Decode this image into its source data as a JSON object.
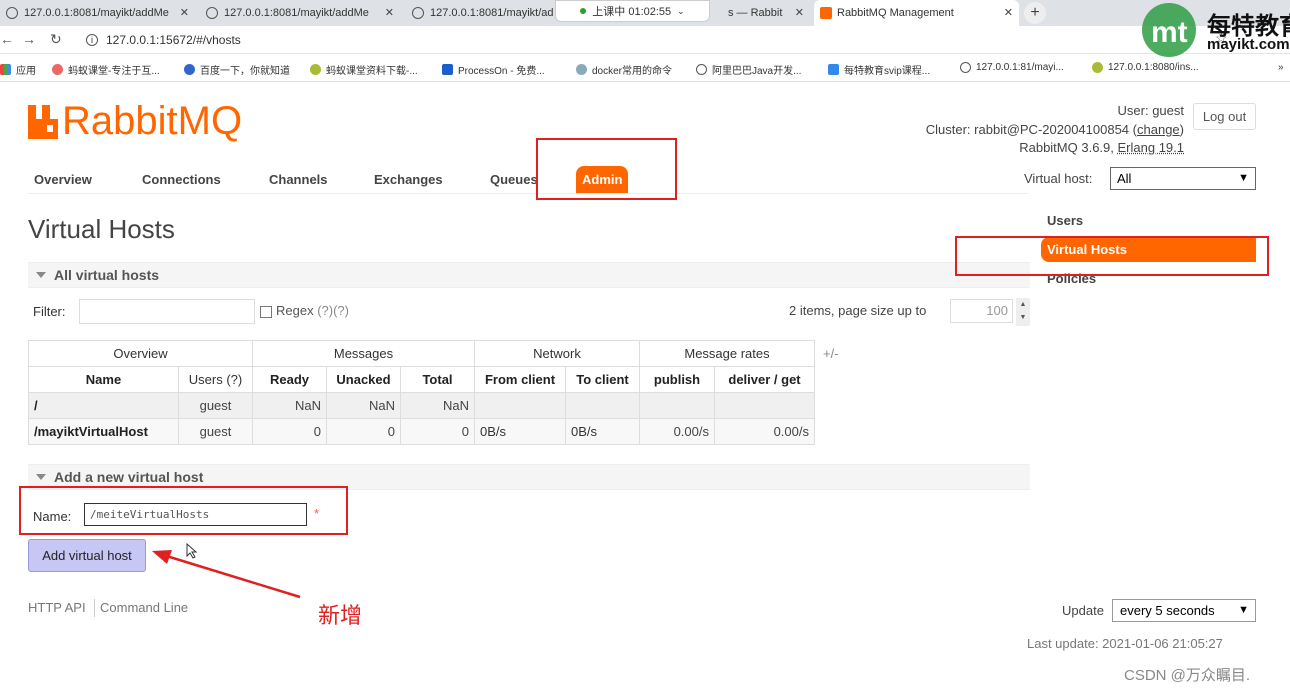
{
  "browser": {
    "tabs": [
      {
        "title": "127.0.0.1:8081/mayikt/addMe"
      },
      {
        "title": "127.0.0.1:8081/mayikt/addMe"
      },
      {
        "title": "127.0.0.1:8081/mayikt/ad"
      },
      {
        "title": "s — Rabbit"
      },
      {
        "title": "RabbitMQ Management"
      }
    ],
    "recording": "上课中 01:02:55",
    "url": "127.0.0.1:15672/#/vhosts",
    "bookmarks": [
      "应用",
      "蚂蚁课堂-专注于互...",
      "百度一下，你就知道",
      "蚂蚁课堂资料下载-...",
      "ProcessOn - 免费...",
      "docker常用的命令",
      "阿里巴巴Java开发...",
      "每特教育svip课程...",
      "127.0.0.1:81/mayi...",
      "127.0.0.1:8080/ins..."
    ],
    "watermark": {
      "line1": "每特教育",
      "line2": "mayikt.com"
    }
  },
  "app": {
    "logo_text": "RabbitMQ",
    "user_label": "User:",
    "user": "guest",
    "logout": "Log out",
    "cluster_label": "Cluster:",
    "cluster": "rabbit@PC-202004100854",
    "change": "change",
    "version": "RabbitMQ 3.6.9,",
    "erlang": "Erlang 19.1",
    "nav": [
      "Overview",
      "Connections",
      "Channels",
      "Exchanges",
      "Queues",
      "Admin"
    ],
    "vhost_label": "Virtual host:",
    "vhost_value": "All",
    "side": [
      "Users",
      "Virtual Hosts",
      "Policies"
    ]
  },
  "page": {
    "title": "Virtual Hosts",
    "all_section": "All virtual hosts",
    "filter_label": "Filter:",
    "regex": "Regex",
    "regex_help": "(?)(?)",
    "items_label": "2 items, page size up to",
    "page_size": "100",
    "plusminus": "+/-",
    "table": {
      "groups": [
        "Overview",
        "Messages",
        "Network",
        "Message rates"
      ],
      "columns": [
        "Name",
        "Users (?)",
        "Ready",
        "Unacked",
        "Total",
        "From client",
        "To client",
        "publish",
        "deliver / get"
      ],
      "rows": [
        {
          "name": "/",
          "users": "guest",
          "ready": "NaN",
          "unacked": "NaN",
          "total": "NaN",
          "from": "",
          "to": "",
          "publish": "",
          "deliver": ""
        },
        {
          "name": "/mayiktVirtualHost",
          "users": "guest",
          "ready": "0",
          "unacked": "0",
          "total": "0",
          "from": "0B/s",
          "to": "0B/s",
          "publish": "0.00/s",
          "deliver": "0.00/s"
        }
      ]
    },
    "add_section": "Add a new virtual host",
    "name_label": "Name:",
    "name_value": "/meiteVirtualHosts",
    "required": "*",
    "add_button": "Add virtual host",
    "footer_http": "HTTP API",
    "footer_cli": "Command Line",
    "update_label": "Update",
    "update_value": "every 5 seconds",
    "last_update": "Last update: 2021-01-06 21:05:27"
  },
  "annotation": "新增",
  "csdn": "CSDN @万众瞩目.",
  "colors": {
    "accent": "#ff6600",
    "annotation": "#e02020",
    "button": "#c7c7f5"
  }
}
